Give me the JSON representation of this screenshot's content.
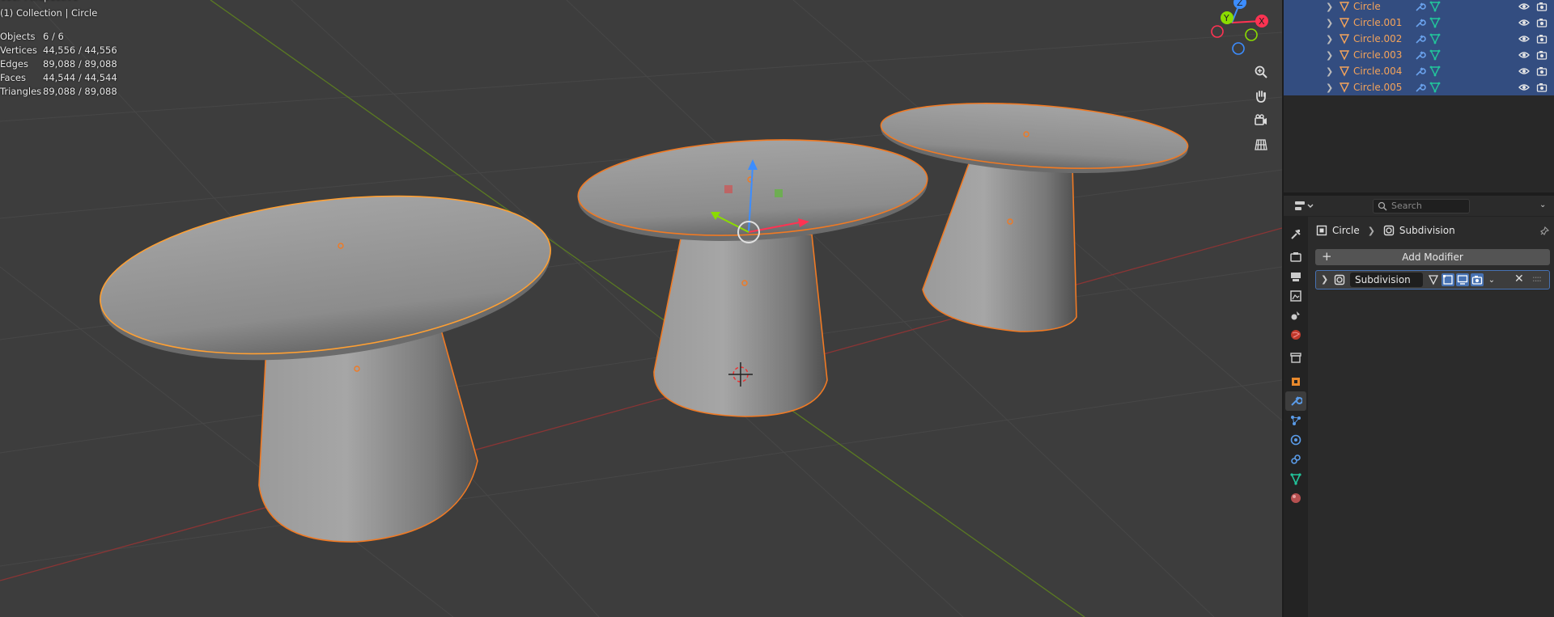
{
  "viewport": {
    "view_name": "User Perspective",
    "collection_line": "(1) Collection | Circle",
    "stats": [
      {
        "label": "Objects",
        "value": "6 / 6"
      },
      {
        "label": "Vertices",
        "value": "44,556 / 44,556"
      },
      {
        "label": "Edges",
        "value": "89,088 / 89,088"
      },
      {
        "label": "Faces",
        "value": "44,544 / 44,544"
      },
      {
        "label": "Triangles",
        "value": "89,088 / 89,088"
      }
    ],
    "gizmo_labels": {
      "x": "X",
      "y": "Y",
      "z": "Z"
    }
  },
  "outliner": {
    "items": [
      {
        "name": "Circle"
      },
      {
        "name": "Circle.001"
      },
      {
        "name": "Circle.002"
      },
      {
        "name": "Circle.003"
      },
      {
        "name": "Circle.004"
      },
      {
        "name": "Circle.005"
      }
    ]
  },
  "properties": {
    "search_placeholder": "Search",
    "breadcrumb": {
      "object": "Circle",
      "modifier": "Subdivision"
    },
    "add_modifier_label": "Add Modifier",
    "modifier": {
      "name": "Subdivision"
    }
  },
  "colors": {
    "selection_outline": "#f07a24",
    "active_outline": "#ffa033",
    "outliner_selected": "#334d80",
    "accent_blue": "#4772b3",
    "object_name": "#f4a35a"
  }
}
